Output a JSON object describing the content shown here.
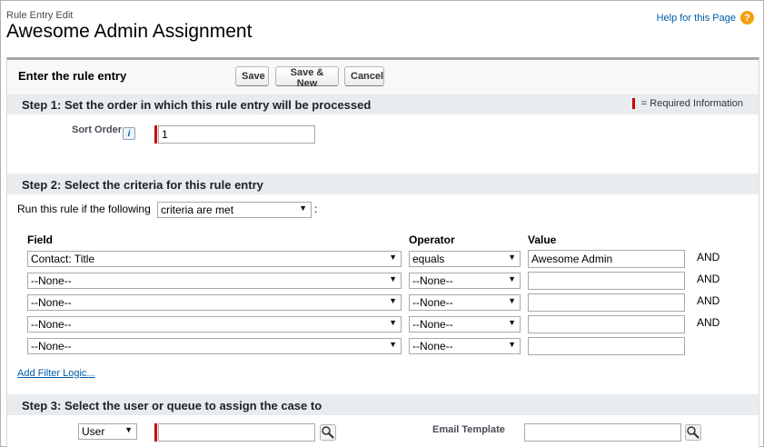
{
  "page": {
    "subtitle": "Rule Entry Edit",
    "title": "Awesome Admin Assignment",
    "help_link": "Help for this Page",
    "help_icon": "?"
  },
  "panel": {
    "header": "Enter the rule entry",
    "buttons": {
      "save": "Save",
      "save_new": "Save & New",
      "cancel": "Cancel"
    }
  },
  "step1": {
    "title": "Step 1: Set the order in which this rule entry will be processed",
    "required_info": "= Required Information",
    "sort_order_label": "Sort Order",
    "info_icon": "i",
    "sort_order_value": "1"
  },
  "step2": {
    "title": "Step 2: Select the criteria for this rule entry",
    "run_rule_text": "Run this rule if the following",
    "criteria_select": "criteria are met",
    "colon": ":",
    "headers": {
      "field": "Field",
      "operator": "Operator",
      "value": "Value"
    },
    "rows": [
      {
        "field": "Contact: Title",
        "operator": "equals",
        "value": "Awesome Admin",
        "conj": "AND"
      },
      {
        "field": "--None--",
        "operator": "--None--",
        "value": "",
        "conj": "AND"
      },
      {
        "field": "--None--",
        "operator": "--None--",
        "value": "",
        "conj": "AND"
      },
      {
        "field": "--None--",
        "operator": "--None--",
        "value": "",
        "conj": "AND"
      },
      {
        "field": "--None--",
        "operator": "--None--",
        "value": "",
        "conj": ""
      }
    ],
    "add_filter_logic": "Add Filter Logic..."
  },
  "step3": {
    "title": "Step 3: Select the user or queue to assign the case to",
    "assignee_type": "User",
    "assignee_value": "",
    "email_template_label": "Email Template",
    "email_template_value": ""
  },
  "colors": {
    "required": "#cc0000",
    "link": "#015ba7",
    "section_bg": "#e9ecef",
    "help_icon": "#f3a10e"
  }
}
